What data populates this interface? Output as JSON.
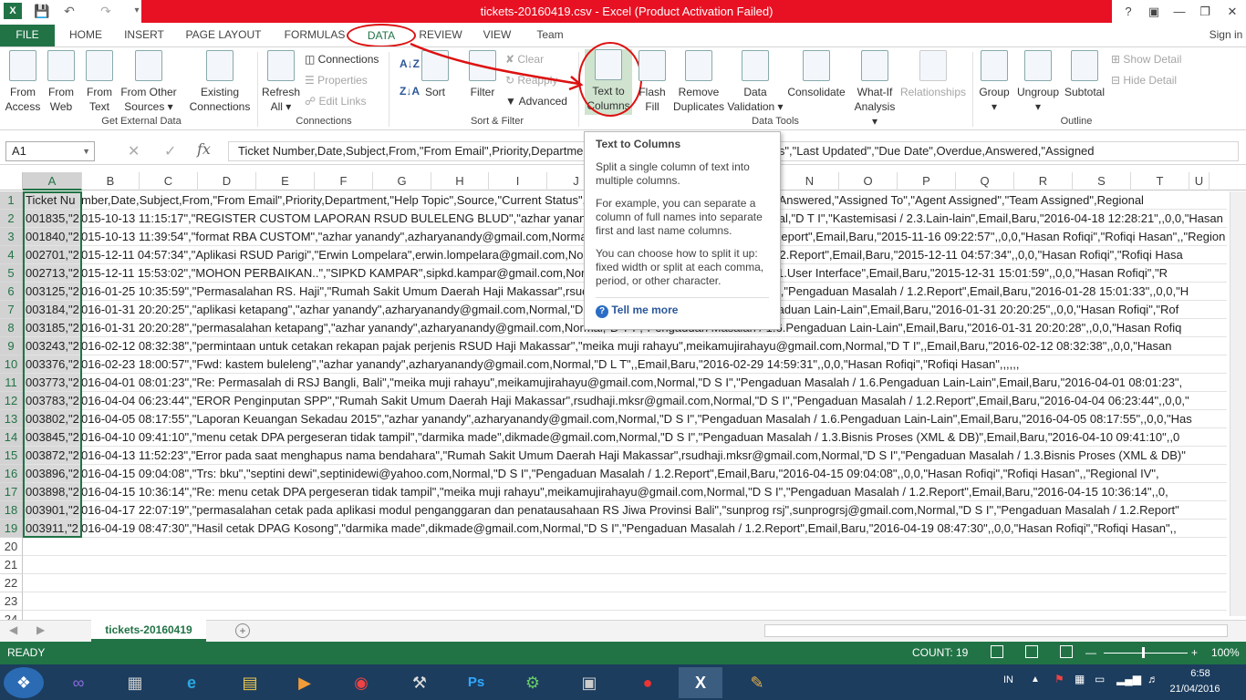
{
  "title": "tickets-20160419.csv -  Excel (Product Activation Failed)",
  "help": "?",
  "signin": "Sign in",
  "tabs": [
    "FILE",
    "HOME",
    "INSERT",
    "PAGE LAYOUT",
    "FORMULAS",
    "DATA",
    "REVIEW",
    "VIEW",
    "Team"
  ],
  "ribbon": {
    "from_access": [
      "From",
      "Access"
    ],
    "from_web": [
      "From",
      "Web"
    ],
    "from_text": [
      "From",
      "Text"
    ],
    "from_other": [
      "From Other",
      "Sources ▾"
    ],
    "existing": [
      "Existing",
      "Connections"
    ],
    "refresh": [
      "Refresh",
      "All ▾"
    ],
    "connections": "Connections",
    "properties": "Properties",
    "edit_links": "Edit Links",
    "sort": "Sort",
    "filter": "Filter",
    "clear": "Clear",
    "reapply": "Reapply",
    "advanced": "Advanced",
    "text_to_columns": [
      "Text to",
      "Columns"
    ],
    "flash_fill": [
      "Flash",
      "Fill"
    ],
    "remove_dup": [
      "Remove",
      "Duplicates"
    ],
    "data_validation": [
      "Data",
      "Validation ▾"
    ],
    "consolidate": "Consolidate",
    "what_if": [
      "What-If",
      "Analysis ▾"
    ],
    "relationships": "Relationships",
    "group": [
      "Group",
      "▾"
    ],
    "ungroup": [
      "Ungroup",
      "▾"
    ],
    "subtotal": "Subtotal",
    "show_detail": "Show Detail",
    "hide_detail": "Hide Detail",
    "groups": [
      "Get External Data",
      "Connections",
      "Sort & Filter",
      "Data Tools",
      "Outline"
    ]
  },
  "namebox": "A1",
  "formula": "Ticket Number,Date,Subject,From,\"From Email\",Priority,Department,\"Help Topic\",Source,\"Current Status\",\"Last Updated\",\"Due Date\",Overdue,Answered,\"Assigned",
  "columns": [
    "A",
    "B",
    "C",
    "D",
    "E",
    "F",
    "G",
    "H",
    "I",
    "J",
    "K",
    "L",
    "M",
    "N",
    "O",
    "P",
    "Q",
    "R",
    "S",
    "T",
    "U"
  ],
  "rows": [
    {
      "n": "1",
      "a": "Ticket Nu",
      "rest": "mber,Date,Subject,From,\"From Email\",Priority,Department,\"Help Topic\",Source,\"Current Status\",\"Last Updated\",\"Due Date\",Overdue,Answered,\"Assigned To\",\"Agent Assigned\",\"Team Assigned\",Regional"
    },
    {
      "n": "2",
      "a": "001835,\"2",
      "rest": "015-10-13 11:15:17\",\"REGISTER CUSTOM LAPORAN RSUD BULELENG BLUD\",\"azhar yanandy\",azharyanandy@gmail.com,Normal,\"D T I\",\"Kastemisasi / 2.3.Lain-lain\",Email,Baru,\"2016-04-18 12:28:21\",,0,0,\"Hasan"
    },
    {
      "n": "3",
      "a": "001840,\"2",
      "rest": "015-10-13 11:39:54\",\"format RBA CUSTOM\",\"azhar yanandy\",azharyanandy@gmail.com,Normal,\"D T I\",\"Pengaduan Masalah / 1.2.Report\",Email,Baru,\"2015-11-16 09:22:57\",,0,0,\"Hasan Rofiqi\",\"Rofiqi Hasan\",,\"Region"
    },
    {
      "n": "4",
      "a": "002701,\"2",
      "rest": "015-12-11 04:57:34\",\"Aplikasi RSUD Parigi\",\"Erwin Lompelara\",erwin.lompelara@gmail.com,Normal,\"D T I\",\"Pengaduan Masalah / 1.2.Report\",Email,Baru,\"2015-12-11 04:57:34\",,0,0,\"Hasan Rofiqi\",\"Rofiqi Hasa"
    },
    {
      "n": "5",
      "a": "002713,\"2",
      "rest": "015-12-11 15:53:02\",\"MOHON PERBAIKAN..\",\"SIPKD KAMPAR\",sipkd.kampar@gmail.com,Normal,\"D T I\",\"Pengaduan Masalah / 1.1.User Interface\",Email,Baru,\"2015-12-31 15:01:59\",,0,0,\"Hasan Rofiqi\",\"R"
    },
    {
      "n": "6",
      "a": "003125,\"2",
      "rest": "016-01-25 10:35:59\",\"Permasalahan RS. Haji\",\"Rumah Sakit Umum Daerah Haji Makassar\",rsudhaji.mksr@gmail.com,Normal,\"D T I\",\"Pengaduan Masalah / 1.2.Report\",Email,Baru,\"2016-01-28 15:01:33\",,0,0,\"H"
    },
    {
      "n": "7",
      "a": "003184,\"2",
      "rest": "016-01-31 20:20:25\",\"aplikasi ketapang\",\"azhar yanandy\",azharyanandy@gmail.com,Normal,\"D T I\",\"Pengaduan Masalah / 1.6.Pengaduan Lain-Lain\",Email,Baru,\"2016-01-31 20:20:25\",,0,0,\"Hasan Rofiqi\",\"Rof"
    },
    {
      "n": "8",
      "a": "003185,\"2",
      "rest": "016-01-31 20:20:28\",\"permasalahan ketapang\",\"azhar yanandy\",azharyanandy@gmail.com,Normal,\"D T I\",\"Pengaduan Masalah / 1.6.Pengaduan Lain-Lain\",Email,Baru,\"2016-01-31 20:20:28\",,0,0,\"Hasan Rofiq"
    },
    {
      "n": "9",
      "a": "003243,\"2",
      "rest": "016-02-12 08:32:38\",\"permintaan untuk cetakan rekapan pajak perjenis RSUD Haji Makassar\",\"meika muji rahayu\",meikamujirahayu@gmail.com,Normal,\"D T I\",,Email,Baru,\"2016-02-12 08:32:38\",,0,0,\"Hasan"
    },
    {
      "n": "10",
      "a": "003376,\"2",
      "rest": "016-02-23 18:00:57\",\"Fwd: kastem buleleng\",\"azhar yanandy\",azharyanandy@gmail.com,Normal,\"D L T\",,Email,Baru,\"2016-02-29 14:59:31\",,0,0,\"Hasan Rofiqi\",\"Rofiqi Hasan\",,,,,,"
    },
    {
      "n": "11",
      "a": "003773,\"2",
      "rest": "016-04-01 08:01:23\",\"Re: Permasalah di RSJ Bangli, Bali\",\"meika muji rahayu\",meikamujirahayu@gmail.com,Normal,\"D S I\",\"Pengaduan Masalah / 1.6.Pengaduan Lain-Lain\",Email,Baru,\"2016-04-01 08:01:23\","
    },
    {
      "n": "12",
      "a": "003783,\"2",
      "rest": "016-04-04 06:23:44\",\"EROR Penginputan SPP\",\"Rumah Sakit Umum Daerah Haji Makassar\",rsudhaji.mksr@gmail.com,Normal,\"D S I\",\"Pengaduan Masalah / 1.2.Report\",Email,Baru,\"2016-04-04 06:23:44\",,0,0,\""
    },
    {
      "n": "13",
      "a": "003802,\"2",
      "rest": "016-04-05 08:17:55\",\"Laporan Keuangan Sekadau 2015\",\"azhar yanandy\",azharyanandy@gmail.com,Normal,\"D S I\",\"Pengaduan Masalah / 1.6.Pengaduan Lain-Lain\",Email,Baru,\"2016-04-05 08:17:55\",,0,0,\"Has"
    },
    {
      "n": "14",
      "a": "003845,\"2",
      "rest": "016-04-10 09:41:10\",\"menu cetak DPA pergeseran tidak tampil\",\"darmika made\",dikmade@gmail.com,Normal,\"D S I\",\"Pengaduan Masalah / 1.3.Bisnis Proses (XML & DB)\",Email,Baru,\"2016-04-10 09:41:10\",,0"
    },
    {
      "n": "15",
      "a": "003872,\"2",
      "rest": "016-04-13 11:52:23\",\"Error pada saat menghapus nama bendahara\",\"Rumah Sakit Umum Daerah Haji Makassar\",rsudhaji.mksr@gmail.com,Normal,\"D S I\",\"Pengaduan Masalah / 1.3.Bisnis Proses (XML & DB)\""
    },
    {
      "n": "16",
      "a": "003896,\"2",
      "rest": "016-04-15 09:04:08\",\"Trs: bku\",\"septini dewi\",septinidewi@yahoo.com,Normal,\"D S I\",\"Pengaduan Masalah / 1.2.Report\",Email,Baru,\"2016-04-15 09:04:08\",,0,0,\"Hasan Rofiqi\",\"Rofiqi Hasan\",,\"Regional IV\","
    },
    {
      "n": "17",
      "a": "003898,\"2",
      "rest": "016-04-15 10:36:14\",\"Re: menu cetak DPA pergeseran tidak tampil\",\"meika muji rahayu\",meikamujirahayu@gmail.com,Normal,\"D S I\",\"Pengaduan Masalah / 1.2.Report\",Email,Baru,\"2016-04-15 10:36:14\",,0,"
    },
    {
      "n": "18",
      "a": "003901,\"2",
      "rest": "016-04-17 22:07:19\",\"permasalahan cetak pada aplikasi modul penganggaran dan penatausahaan RS Jiwa Provinsi Bali\",\"sunprog rsj\",sunprogrsj@gmail.com,Normal,\"D S I\",\"Pengaduan Masalah / 1.2.Report\""
    },
    {
      "n": "19",
      "a": "003911,\"2",
      "rest": "016-04-19 08:47:30\",\"Hasil cetak DPAG Kosong\",\"darmika made\",dikmade@gmail.com,Normal,\"D S I\",\"Pengaduan Masalah / 1.2.Report\",Email,Baru,\"2016-04-19 08:47:30\",,0,0,\"Hasan Rofiqi\",\"Rofiqi Hasan\",,"
    },
    {
      "n": "20",
      "a": "",
      "rest": ""
    },
    {
      "n": "21",
      "a": "",
      "rest": ""
    },
    {
      "n": "22",
      "a": "",
      "rest": ""
    },
    {
      "n": "23",
      "a": "",
      "rest": ""
    },
    {
      "n": "24",
      "a": "",
      "rest": ""
    }
  ],
  "tooltip": {
    "title": "Text to Columns",
    "p1": "Split a single column of text into multiple columns.",
    "p2": "For example, you can separate a column of full names into separate first and last name columns.",
    "p3": "You can choose how to split it up: fixed width or split at each comma, period, or other character.",
    "more": "Tell me more"
  },
  "sheet_tab": "tickets-20160419",
  "status": {
    "ready": "READY",
    "count": "COUNT: 19",
    "zoom": "100%"
  },
  "taskbar": {
    "lang": "IN",
    "time": "6:58",
    "date": "21/04/2016"
  },
  "colors": {
    "excel_green": "#217346",
    "title_red": "#e81123",
    "annotation_red": "#d11"
  }
}
